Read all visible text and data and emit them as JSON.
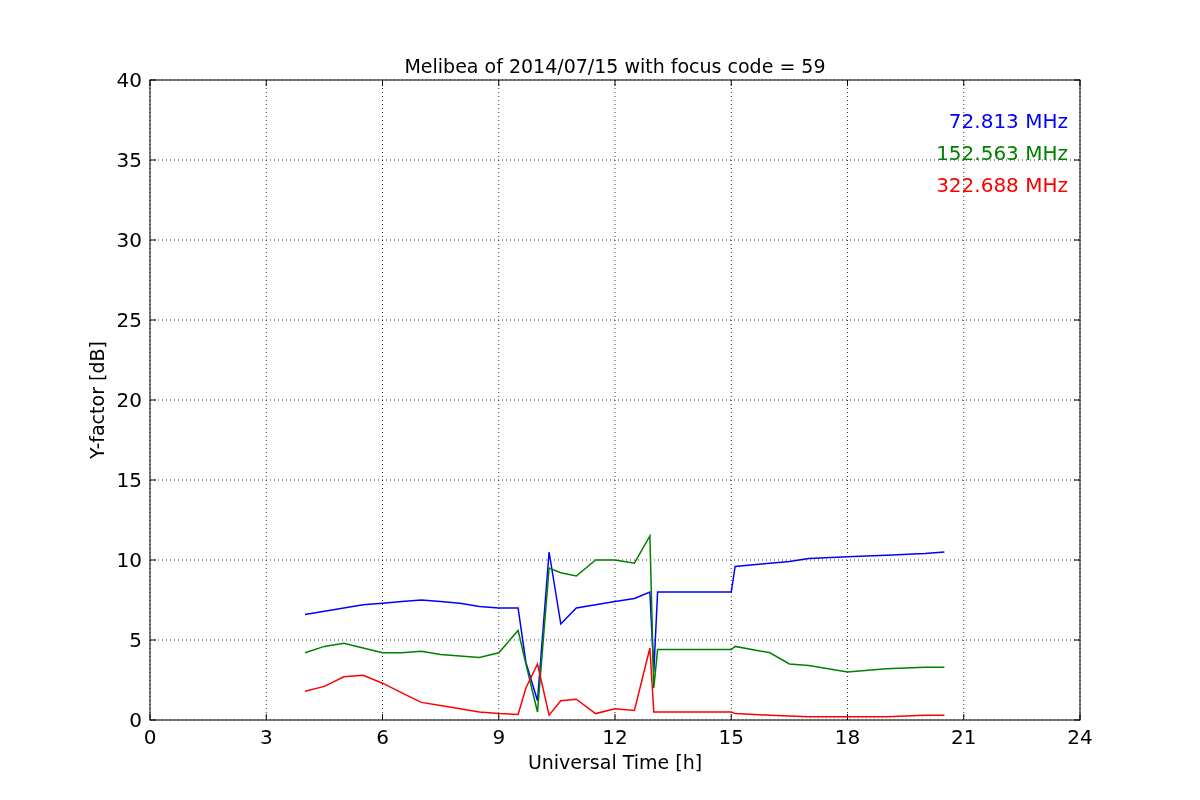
{
  "figure": {
    "chart_data": {
      "type": "line",
      "title": "Melibea of 2014/07/15 with focus code = 59",
      "xlabel": "Universal Time [h]",
      "ylabel": "Y-factor [dB]",
      "x": [
        4,
        4.5,
        5,
        5.5,
        6,
        6.5,
        7,
        7.5,
        8,
        8.5,
        9,
        9.5,
        9.7,
        10,
        10.3,
        10.6,
        11,
        11.5,
        12,
        12.5,
        12.9,
        13,
        13.1,
        14,
        15,
        15.1,
        16,
        16.5,
        17,
        18,
        19,
        20,
        20.5
      ],
      "series": [
        {
          "name": "72.813 MHz",
          "color": "#0000ff",
          "values": [
            6.6,
            6.8,
            7.0,
            7.2,
            7.3,
            7.4,
            7.5,
            7.4,
            7.3,
            7.1,
            7.0,
            7.0,
            3.6,
            1.2,
            10.5,
            6.0,
            7.0,
            7.2,
            7.4,
            7.6,
            8.0,
            3.0,
            8.0,
            8.0,
            8.0,
            9.6,
            9.8,
            9.9,
            10.1,
            10.2,
            10.3,
            10.4,
            10.5
          ]
        },
        {
          "name": "152.563 MHz",
          "color": "#008000",
          "values": [
            4.2,
            4.6,
            4.8,
            4.5,
            4.2,
            4.2,
            4.3,
            4.1,
            4.0,
            3.9,
            4.2,
            5.6,
            3.5,
            0.5,
            9.5,
            9.2,
            9.0,
            10.0,
            10.0,
            9.8,
            11.5,
            2.0,
            4.4,
            4.4,
            4.4,
            4.6,
            4.2,
            3.5,
            3.4,
            3.0,
            3.2,
            3.3,
            3.3
          ]
        },
        {
          "name": "322.688 MHz",
          "color": "#ff0000",
          "values": [
            1.8,
            2.1,
            2.7,
            2.8,
            2.3,
            1.7,
            1.1,
            0.9,
            0.7,
            0.5,
            0.4,
            0.35,
            2.0,
            3.5,
            0.3,
            1.2,
            1.3,
            0.4,
            0.7,
            0.6,
            4.5,
            0.5,
            0.5,
            0.5,
            0.5,
            0.4,
            0.3,
            0.25,
            0.2,
            0.2,
            0.2,
            0.3,
            0.3
          ]
        }
      ],
      "grid": true,
      "xlim": [
        0,
        24
      ],
      "ylim": [
        0,
        40
      ],
      "xticks": [
        0,
        3,
        6,
        9,
        12,
        15,
        18,
        21,
        24
      ],
      "yticks": [
        0,
        5,
        10,
        15,
        20,
        25,
        30,
        35,
        40
      ]
    }
  }
}
